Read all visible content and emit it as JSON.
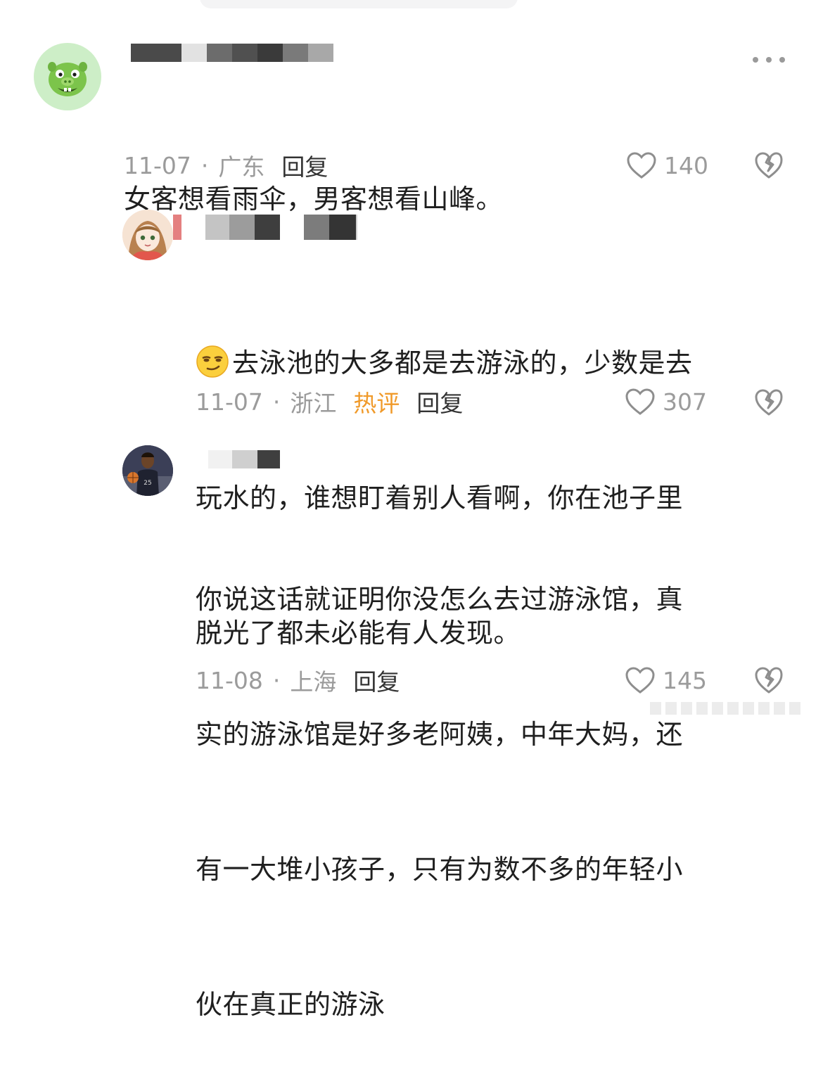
{
  "comments": [
    {
      "text_lines": [
        "女客想看雨伞，男客想看山峰。"
      ],
      "date": "11-07",
      "location": "广东",
      "reply_label": "回复",
      "likes": "140"
    },
    {
      "emoji": "smirk-face",
      "text_lines": [
        "去泳池的大多都是去游泳的，少数是去",
        "玩水的，谁想盯着别人看啊，你在池子里",
        "脱光了都未必能有人发现。"
      ],
      "date": "11-07",
      "location": "浙江",
      "hot_label": "热评",
      "reply_label": "回复",
      "likes": "307"
    },
    {
      "text_lines": [
        "你说这话就证明你没怎么去过游泳馆，真",
        "实的游泳馆是好多老阿姨，中年大妈，还",
        "有一大堆小孩子，只有为数不多的年轻小",
        "伙在真正的游泳"
      ],
      "date": "11-08",
      "location": "上海",
      "reply_label": "回复",
      "likes": "145"
    }
  ],
  "separator": "·",
  "colors": {
    "meta": "#9b9b9b",
    "hot": "#f09a2a",
    "text": "#1f1f1f",
    "avatar_green": "#c9ecc4"
  },
  "icons": [
    "more-icon",
    "heart-icon",
    "dislike-heart-icon",
    "pig-avatar-icon"
  ]
}
